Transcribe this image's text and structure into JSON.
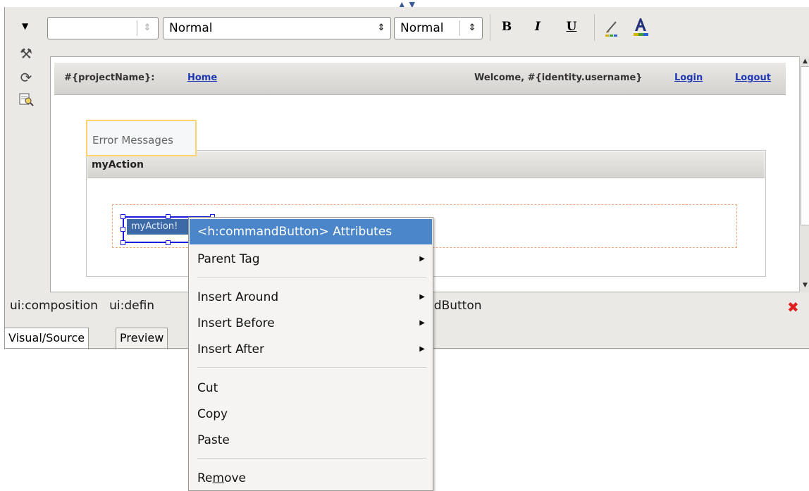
{
  "toolbar": {
    "font_family_value": "",
    "style_value": "Normal",
    "size_value": "Normal",
    "bold_label": "B",
    "italic_label": "I",
    "underline_label": "U"
  },
  "header": {
    "project": "#{projectName}:",
    "home_link": "Home",
    "welcome": "Welcome, #{identity.username}",
    "login_link": "Login",
    "logout_link": "Logout"
  },
  "content": {
    "error_messages": "Error Messages",
    "form_title": "myAction",
    "button_label": "myAction!"
  },
  "breadcrumb": {
    "items": [
      "ui:composition",
      "ui:defin"
    ],
    "tail": "ndButton"
  },
  "tabs": [
    "Visual/Source",
    "Preview"
  ],
  "context_menu": {
    "attributes": "<h:commandButton> Attributes",
    "parent_tag": "Parent Tag",
    "insert_around": "Insert Around",
    "insert_before": "Insert Before",
    "insert_after": "Insert After",
    "cut": "Cut",
    "copy": "Copy",
    "paste": "Paste",
    "remove_pre": "Re",
    "remove_mnemonic": "m",
    "remove_post": "ove"
  },
  "icons": [
    "dropdown-arrow-icon",
    "tools-icon",
    "refresh-icon",
    "preview-icon",
    "brush-icon",
    "font-color-icon",
    "close-icon",
    "submenu-arrow-icon"
  ],
  "colors": {
    "menu_highlight": "#4a86c9",
    "link": "#1f39b4",
    "selection": "#1b1be0",
    "close": "#e02020"
  }
}
